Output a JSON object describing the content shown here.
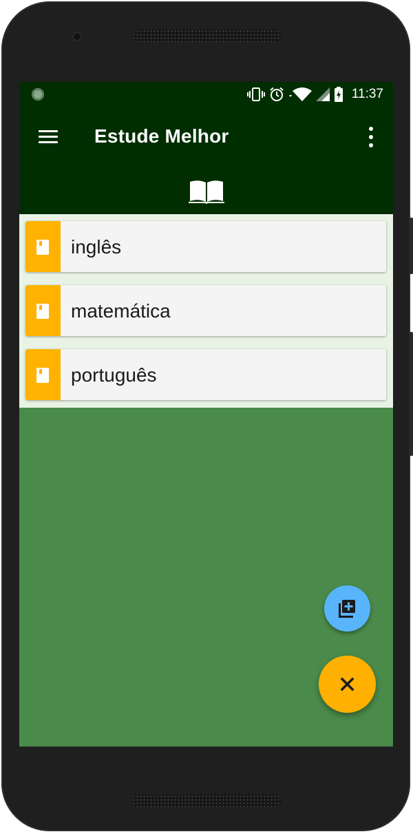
{
  "status_bar": {
    "time": "11:37",
    "icons": [
      "app-notification-icon",
      "vibrate-icon",
      "alarm-icon",
      "wifi-icon",
      "cell-signal-icon",
      "battery-charging-icon"
    ]
  },
  "app_bar": {
    "title": "Estude Melhor",
    "menu_icon": "hamburger-menu-icon",
    "overflow_icon": "more-vert-icon",
    "tab_icon": "open-book-icon"
  },
  "subjects": [
    {
      "label": "inglês",
      "icon": "book-icon"
    },
    {
      "label": "matemática",
      "icon": "book-icon"
    },
    {
      "label": "português",
      "icon": "book-icon"
    }
  ],
  "fabs": {
    "add": {
      "icon": "library-add-icon"
    },
    "close": {
      "icon": "close-icon"
    }
  },
  "colors": {
    "app_bar": "#002e00",
    "background": "#4a8a4a",
    "list_background": "#e8f3e6",
    "accent": "#ffb300",
    "fab_secondary": "#58b4fb"
  }
}
